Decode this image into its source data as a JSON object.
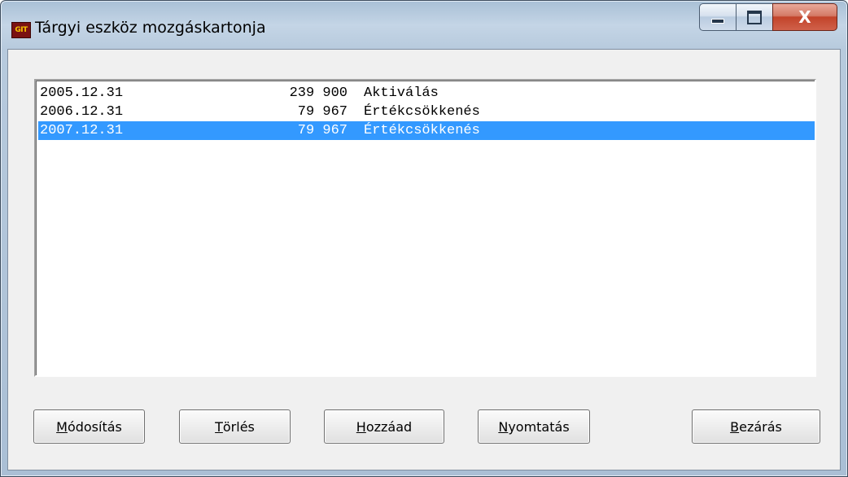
{
  "window": {
    "title": "Tárgyi eszköz mozgáskartonja",
    "app_icon_text": "GIT",
    "icon": "app-icon",
    "controls": {
      "minimize_icon": "minimize-icon",
      "maximize_icon": "maximize-icon",
      "close_label": "X"
    }
  },
  "list": {
    "rows": [
      {
        "date": "2005.12.31",
        "amount": "239 900",
        "description": "Aktiválás",
        "selected": false
      },
      {
        "date": "2006.12.31",
        "amount": "79 967",
        "description": "Értékcsökkenés",
        "selected": false
      },
      {
        "date": "2007.12.31",
        "amount": "79 967",
        "description": "Értékcsökkenés",
        "selected": true
      }
    ],
    "selection_color": "#3399ff"
  },
  "buttons": {
    "modify": {
      "mnemonic": "M",
      "rest": "ódosítás"
    },
    "delete": {
      "mnemonic": "T",
      "rest": "örlés"
    },
    "add": {
      "mnemonic": "H",
      "rest": "ozzáad"
    },
    "print": {
      "mnemonic": "N",
      "rest": "yomtatás"
    },
    "close": {
      "mnemonic": "B",
      "rest": "ezárás"
    }
  }
}
